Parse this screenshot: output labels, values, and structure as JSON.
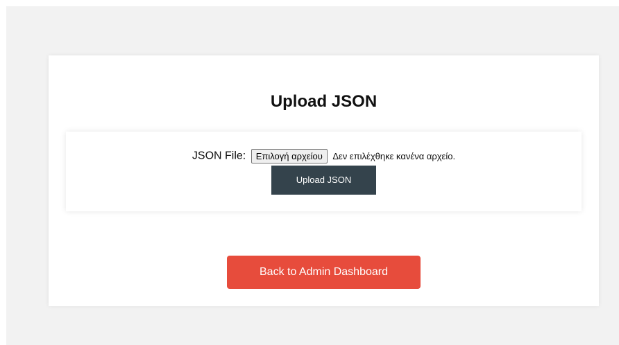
{
  "page": {
    "title": "Upload JSON"
  },
  "form": {
    "file_label": "JSON File:",
    "file_button_label": "Επιλογή αρχείου",
    "file_status": "Δεν επιλέχθηκε κανένα αρχείο.",
    "submit_label": "Upload JSON"
  },
  "nav": {
    "back_label": "Back to Admin Dashboard"
  },
  "colors": {
    "page_background": "#f2f2f2",
    "card_background": "#ffffff",
    "upload_button": "#34434c",
    "back_button": "#e74c3c"
  }
}
